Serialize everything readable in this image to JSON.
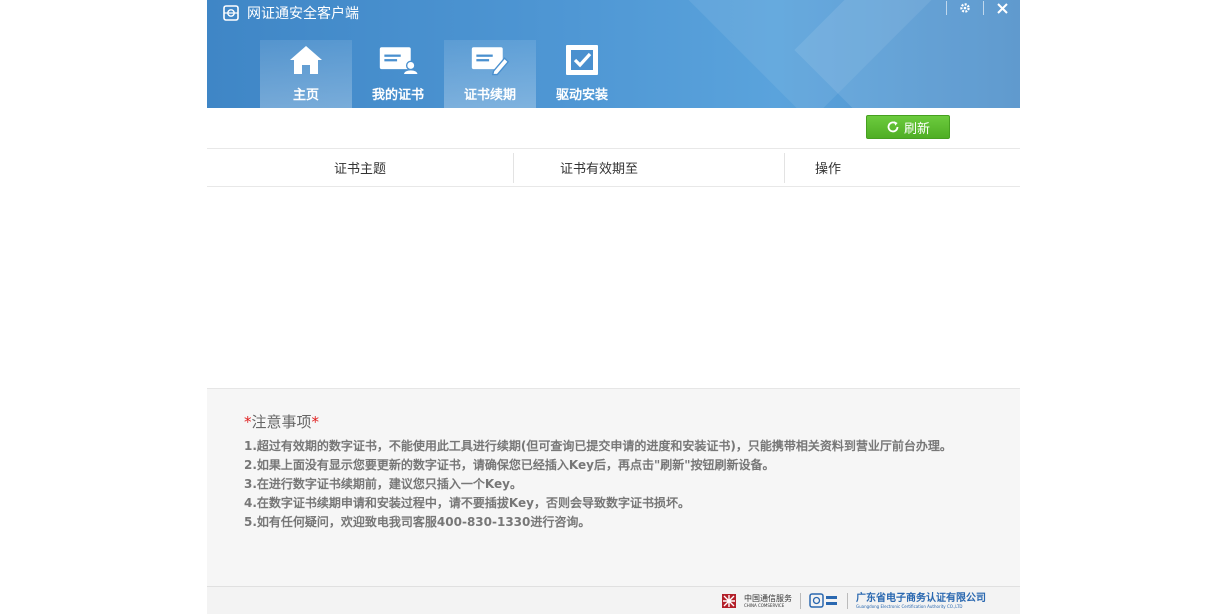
{
  "app": {
    "title": "网证通安全客户端",
    "settings_icon": "gear-icon",
    "close_icon": "close-icon"
  },
  "tabs": [
    {
      "label": "主页",
      "icon": "home-icon",
      "active": true
    },
    {
      "label": "我的证书",
      "icon": "certificate-user-icon",
      "active": false
    },
    {
      "label": "证书续期",
      "icon": "certificate-renew-icon",
      "active": true
    },
    {
      "label": "驱动安装",
      "icon": "checkbox-install-icon",
      "active": false
    }
  ],
  "toolbar": {
    "refresh_label": "刷新",
    "refresh_color": "#5bbf2e"
  },
  "table": {
    "columns": [
      "证书主题",
      "证书有效期至",
      "操作"
    ],
    "rows": []
  },
  "notes": {
    "star": "*",
    "title": "注意事项",
    "items": [
      "1.超过有效期的数字证书，不能使用此工具进行续期(但可查询已提交申请的进度和安装证书)，只能携带相关资料到营业厅前台办理。",
      "2.如果上面没有显示您要更新的数字证书，请确保您已经插入Key后，再点击\"刷新\"按钮刷新设备。",
      "3.在进行数字证书续期前，建议您只插入一个Key。",
      "4.在数字证书续期申请和安装过程中，请不要插拔Key，否则会导致数字证书损坏。",
      "5.如有任何疑问，欢迎致电我司客服400-830-1330进行咨询。"
    ]
  },
  "footer": {
    "logo1_cn": "中国通信服务",
    "logo1_en": "CHINA COMSERVICE",
    "logo3_cn": "广东省电子商务认证有限公司",
    "logo3_en": "Guangdong Electronic Certification Authority CO.,LTD"
  },
  "colors": {
    "header_blue": "#4a90cf",
    "accent_red": "#e02020"
  }
}
